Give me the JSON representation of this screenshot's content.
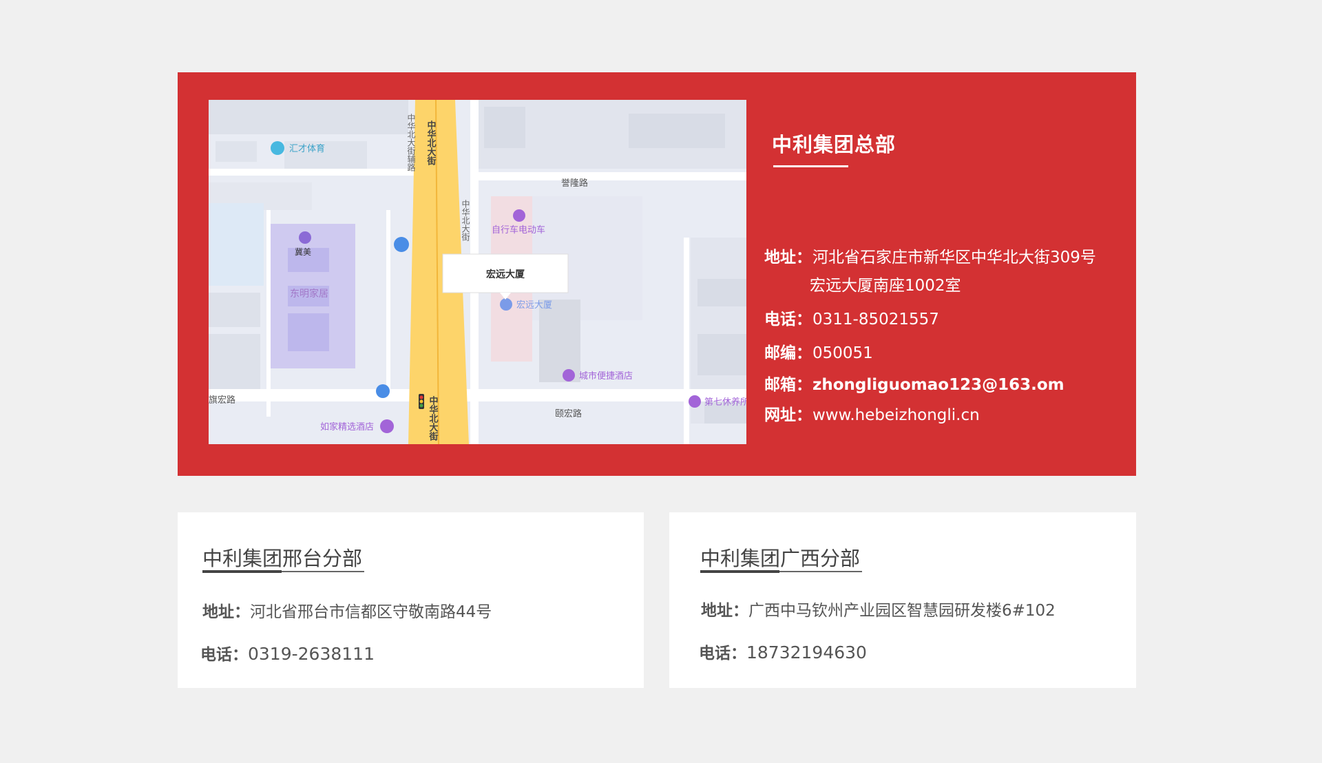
{
  "headquarters": {
    "title": "中利集团总部",
    "address_label": "地址：",
    "address_line1": "河北省石家庄市新华区中华北大街309号",
    "address_line2": "宏远大厦南座1002室",
    "phone_label": "电话：",
    "phone": "0311-85021557",
    "postcode_label": "邮编：",
    "postcode": "050051",
    "email_label": "邮箱：",
    "email": "zhongliguomao123@163.om",
    "website_label": "网址：",
    "website": "www.hebeizhongli.cn"
  },
  "map": {
    "marker_label": "宏远大厦",
    "labels": {
      "huicai": "汇才体育",
      "zhonghua_main": "中华北大街",
      "zhonghua_aux": "中华北大街辅路",
      "zhonghua_east": "中华北大街",
      "yulong": "誉隆路",
      "bike_shop": "自行车电动车",
      "jimei": "冀美",
      "dongming": "东明家居",
      "hongyuan_poi": "宏远大厦",
      "city_hotel": "城市便捷酒店",
      "qihongroad_left": "旗宏路",
      "qihongroad_right": "颐宏路",
      "rujia": "如家精选酒店",
      "diqixiuxian": "第七休养所",
      "zhonghua_bottom": "中华北大街"
    }
  },
  "branches": [
    {
      "title": "中利集团邢台分部",
      "address_label": "地址：",
      "address": "河北省邢台市信都区守敬南路44号",
      "phone_label": "电话：",
      "phone": "0319-2638111"
    },
    {
      "title": "中利集团广西分部",
      "address_label": "地址：",
      "address": "广西中马钦州产业园区智慧园研发楼6#102",
      "phone_label": "电话：",
      "phone": "18732194630"
    }
  ],
  "colors": {
    "accent_red": "#d33133",
    "page_bg": "#f0f0f0",
    "card_bg": "#ffffff",
    "road_yellow": "#fdd46a"
  }
}
